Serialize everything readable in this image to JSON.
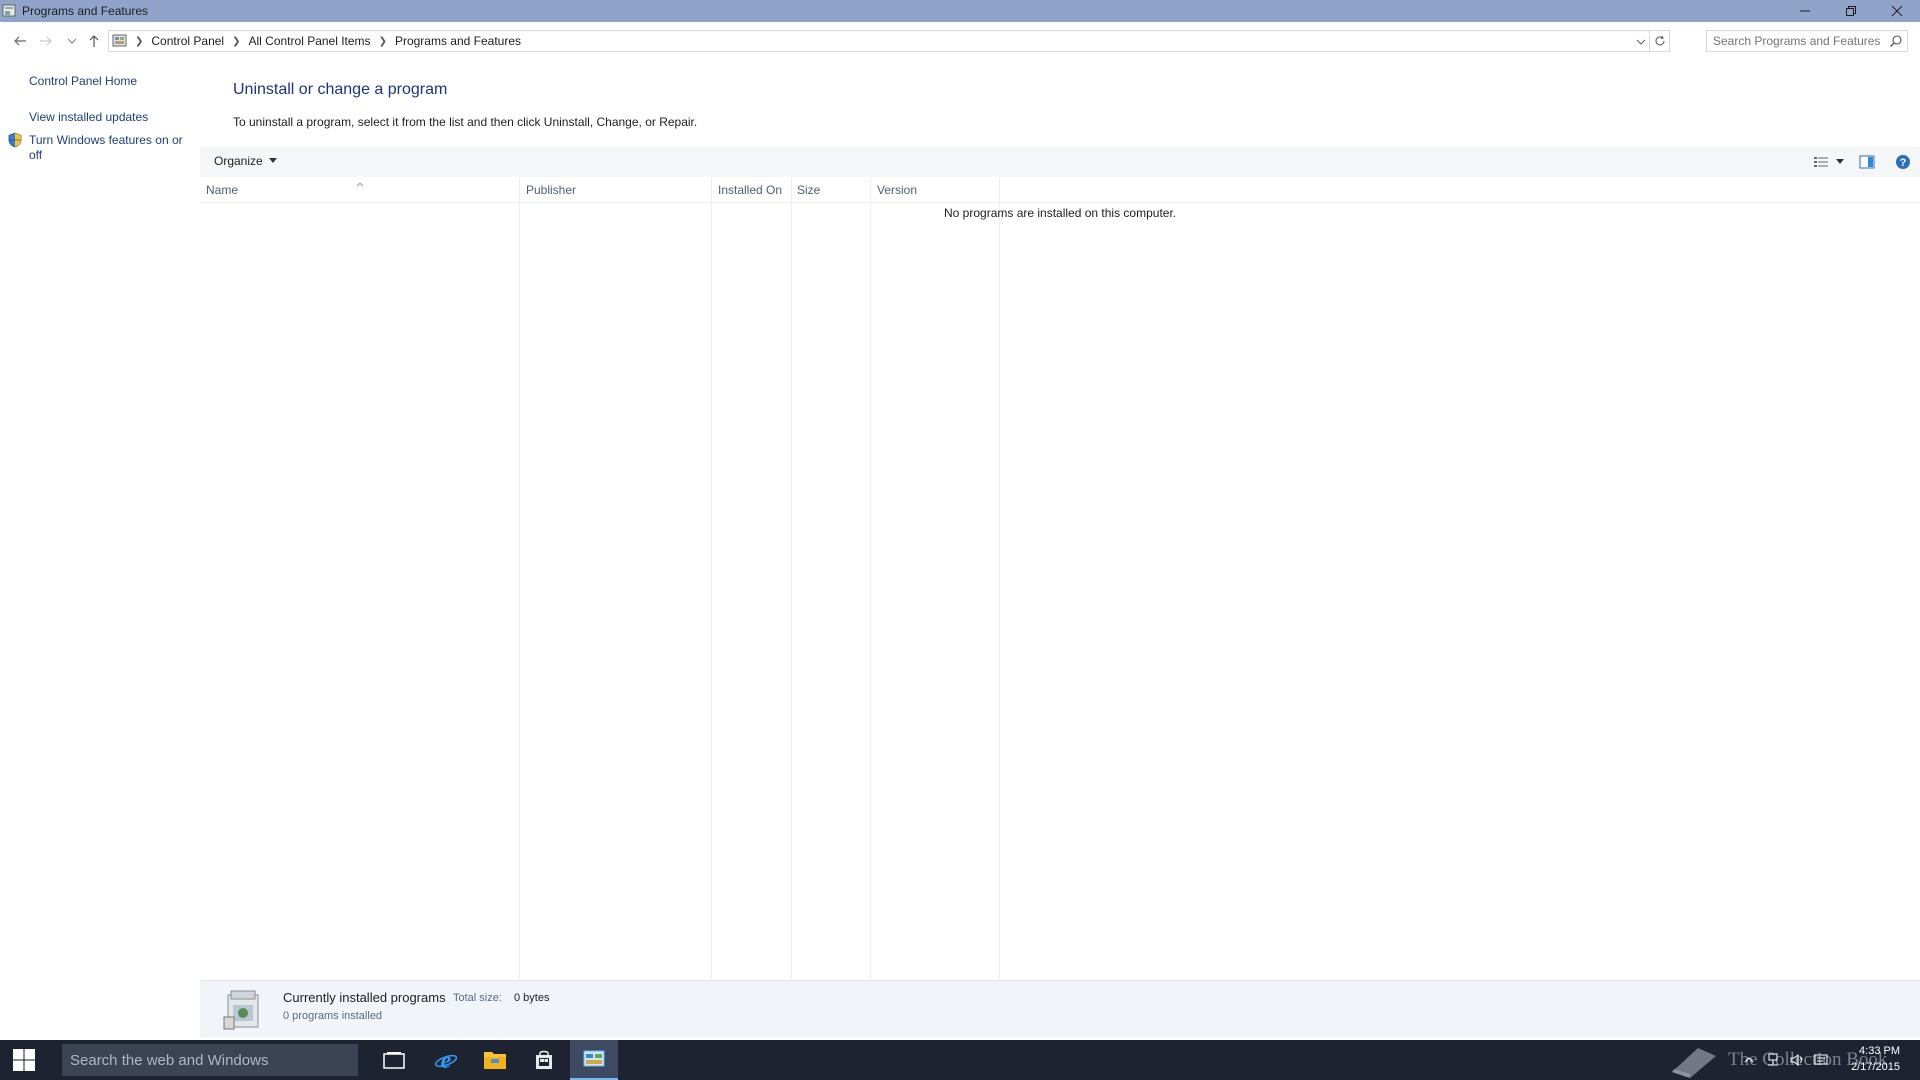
{
  "window": {
    "title": "Programs and Features"
  },
  "address": {
    "crumbs": [
      "Control Panel",
      "All Control Panel Items",
      "Programs and Features"
    ],
    "search_placeholder": "Search Programs and Features"
  },
  "leftpane": {
    "home": "Control Panel Home",
    "updates": "View installed updates",
    "features_line1": "Turn Windows features on or",
    "features_line2": "off"
  },
  "main": {
    "title": "Uninstall or change a program",
    "description": "To uninstall a program, select it from the list and then click Uninstall, Change, or Repair.",
    "organize_label": "Organize",
    "columns": [
      "Name",
      "Publisher",
      "Installed On",
      "Size",
      "Version"
    ],
    "empty_message": "No programs are installed on this computer."
  },
  "details": {
    "heading": "Currently installed programs",
    "total_size_label": "Total size:",
    "total_size_value": "0 bytes",
    "count": "0 programs installed"
  },
  "taskbar": {
    "search_placeholder": "Search the web and Windows",
    "watermark": "The Collection Book",
    "time": "4:33 PM",
    "date": "2/17/2015"
  },
  "colors": {
    "titlebar": "#8fa4c8",
    "link": "#1c3e7f",
    "heading": "#1e3287",
    "taskbar": "#1d2331",
    "accent": "#76b9ed"
  }
}
